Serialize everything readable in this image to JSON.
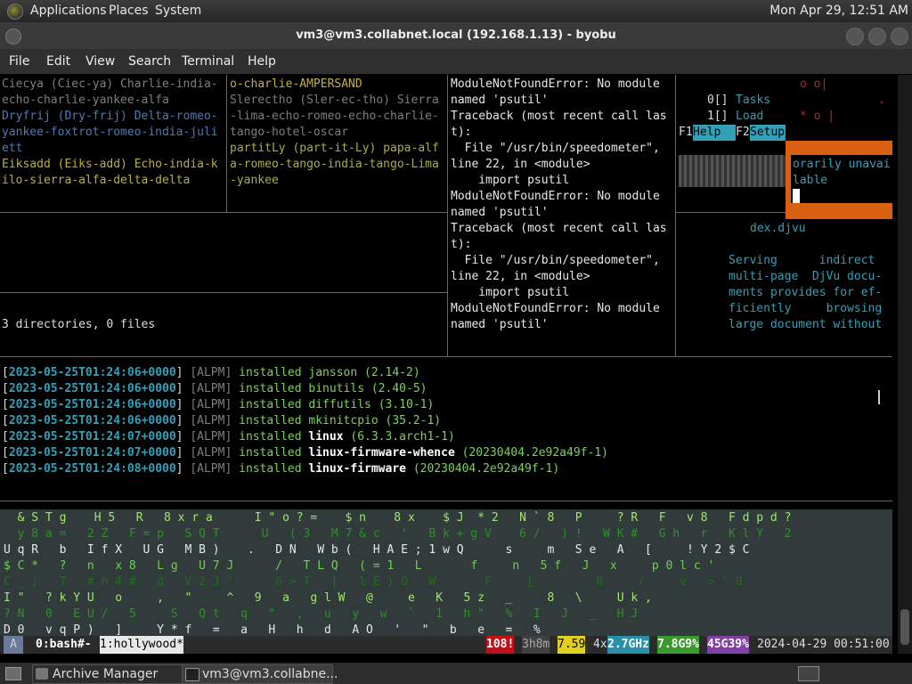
{
  "panel": {
    "menus": [
      "Applications",
      "Places",
      "System"
    ],
    "clock": "Mon Apr 29, 12:51 AM"
  },
  "window": {
    "title": "vm3@vm3.collabnet.local (192.168.1.13) - byobu",
    "menus": [
      "File",
      "Edit",
      "View",
      "Search",
      "Terminal",
      "Help"
    ]
  },
  "pane_words_left": [
    "Ciecya (Ciec-ya) Charlie-india-",
    "echo-charlie-yankee-alfa",
    "Dryfrij (Dry-frij) Delta-romeo-",
    "yankee-foxtrot-romeo-india-juli",
    "ett",
    "Eiksadd (Eiks-add) Echo-india-k",
    "ilo-sierra-alfa-delta-delta"
  ],
  "pane_words_right": [
    "o-charlie-AMPERSAND",
    "Slerectho (Sler-ec-tho) Sierra",
    "-lima-echo-romeo-echo-charlie-",
    "tango-hotel-oscar",
    "partitLy (part-it-Ly) papa-alf",
    "a-romeo-tango-india-tango-Lima",
    "-yankee"
  ],
  "tree_summary": "3 directories, 0 files",
  "python_error": [
    "ModuleNotFoundError: No module",
    "named 'psutil'",
    "Traceback (most recent call las",
    "t):",
    "  File \"/usr/bin/speedometer\",",
    "line 22, in <module>",
    "    import psutil",
    "ModuleNotFoundError: No module",
    "named 'psutil'",
    "Traceback (most recent call las",
    "t):",
    "  File \"/usr/bin/speedometer\",",
    "line 22, in <module>",
    "    import psutil",
    "ModuleNotFoundError: No module",
    "named 'psutil'"
  ],
  "htop": {
    "top1": "o o|",
    "tasks_num": "0[]",
    "tasks_label": "Tasks",
    "load_num": "1[]",
    "load_label": "Load",
    "top2": "* o |",
    "top2b": ".",
    "f1": "F1",
    "f1_label": "Help",
    "f2": "F2",
    "f2_label": "Setup"
  },
  "popup": {
    "line1": "orarily unavai",
    "line2": "lable"
  },
  "man": {
    "file": "dex.djvu",
    "lines": [
      "Serving      indirect",
      "multi-page  DjVu docu-",
      "ments provides for ef-",
      "ficiently     browsing",
      "large document without"
    ]
  },
  "pacman_log": [
    {
      "ts": "2023-05-25T01:24:06+0000",
      "tag": "[ALPM]",
      "action": "installed",
      "pkg": "jansson",
      "ver": "(2.14-2)",
      "bold": false
    },
    {
      "ts": "2023-05-25T01:24:06+0000",
      "tag": "[ALPM]",
      "action": "installed",
      "pkg": "binutils",
      "ver": "(2.40-5)",
      "bold": false
    },
    {
      "ts": "2023-05-25T01:24:06+0000",
      "tag": "[ALPM]",
      "action": "installed",
      "pkg": "diffutils",
      "ver": "(3.10-1)",
      "bold": false
    },
    {
      "ts": "2023-05-25T01:24:06+0000",
      "tag": "[ALPM]",
      "action": "installed",
      "pkg": "mkinitcpio",
      "ver": "(35.2-1)",
      "bold": false
    },
    {
      "ts": "2023-05-25T01:24:07+0000",
      "tag": "[ALPM]",
      "action": "installed",
      "pkg": "linux",
      "ver": "(6.3.3.arch1-1)",
      "bold": true
    },
    {
      "ts": "2023-05-25T01:24:07+0000",
      "tag": "[ALPM]",
      "action": "installed",
      "pkg": "linux-firmware-whence",
      "ver": "(20230404.2e92a49f-1)",
      "bold": true
    },
    {
      "ts": "2023-05-25T01:24:08+0000",
      "tag": "[ALPM]",
      "action": "installed",
      "pkg": "linux-firmware",
      "ver": "(20230404.2e92a49f-1)",
      "bold": true
    }
  ],
  "rain_rows": [
    "  & S T g    H 5   R   8 x r a      I \" o ? =    $ n    8 x    $ J  * 2   N ` 8   P     ? R   F   v 8   F d p d ? ",
    "  y 8 a =   2 Z   F = p   S Q T      U   ( 3   M 7 & c   '   B k + g V    6 /   ) !   W K #   G h   r   K l Y   2",
    "U q R   b   I f X   U G   M B )    .   D N   W b (   H A E ; 1 w Q      s     m   S e   A   [     ! Y 2 $ C",
    "$ C *   ?   n   x 8   L g   U 7 J      /   T L Q   ( = 1   L       f     n   5 f   J   x     p 0 l c '",
    "C _ ;   T   # h 4 #   d   V 2 J '      G > T   [   l E ) O   W       F     [         8     /     v   > ' 0",
    "I \"   ? k Y U   o     ,   \"     ^   9   a   g l W   @     e   K   5 z   _     8   \\     U k ,",
    "? N   0   E U /   5     S   Q t   q   \"   ,   u   y   w   `   1   h \"   %   I   J   _   H J",
    "D 0   v q P )   ]     Y * f   =   a   H   h   d   A O   '   \"   b   e   =   %"
  ],
  "statusbar": {
    "indicator": "A",
    "win0": "0:bash#-",
    "win1": "1:hollywood*",
    "updates": "108!",
    "uptime": "3h8m",
    "load": "7.59",
    "cpu_count": "4x",
    "cpu_freq": "2.7GHz",
    "mem": "7.8G9%",
    "disk": "45G39%",
    "datetime": "2024-04-29 00:51:00"
  },
  "taskbar": {
    "items": [
      "Archive Manager",
      "vm3@vm3.collabne..."
    ]
  },
  "colors": {
    "green": "#7cd35a",
    "cyan": "#34a0b8",
    "orange": "#d86010",
    "red": "#e0102a"
  }
}
